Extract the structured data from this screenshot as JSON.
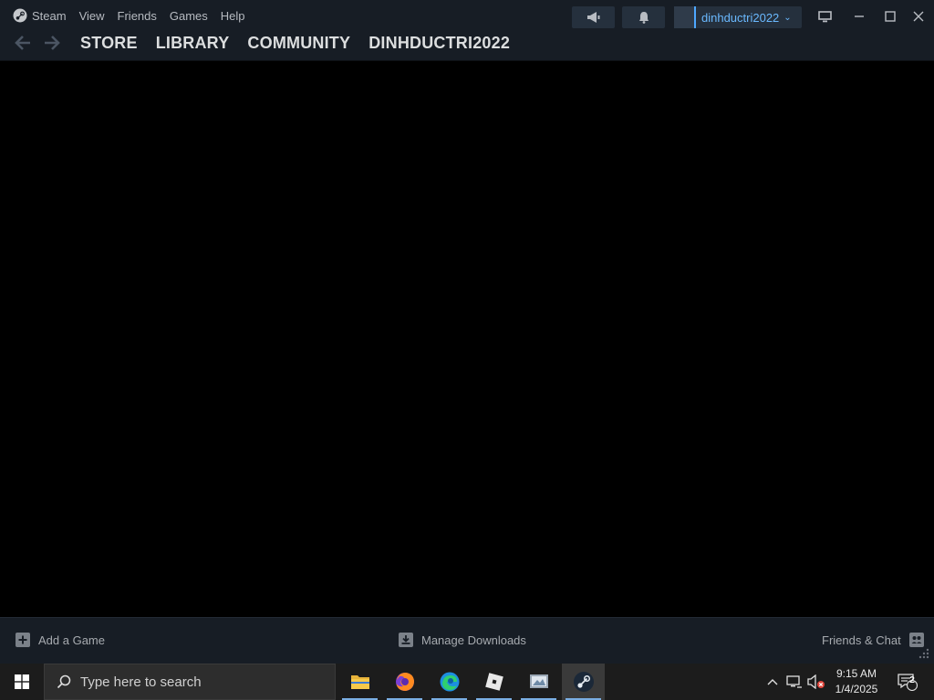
{
  "menu": {
    "steam": "Steam",
    "view": "View",
    "friends": "Friends",
    "games": "Games",
    "help": "Help"
  },
  "nav": {
    "store": "STORE",
    "library": "LIBRARY",
    "community": "COMMUNITY",
    "profile": "DINHDUCTRI2022"
  },
  "account": {
    "username": "dinhductri2022"
  },
  "bottom": {
    "add_game": "Add a Game",
    "manage_downloads": "Manage Downloads",
    "friends_chat": "Friends & Chat"
  },
  "taskbar": {
    "search_placeholder": "Type here to search",
    "time": "9:15 AM",
    "date": "1/4/2025",
    "notifications_count": "2"
  },
  "colors": {
    "titlebar_bg": "#171d25",
    "accent_blue": "#6ab9ff",
    "taskbar_bg": "#1c1c1c"
  }
}
